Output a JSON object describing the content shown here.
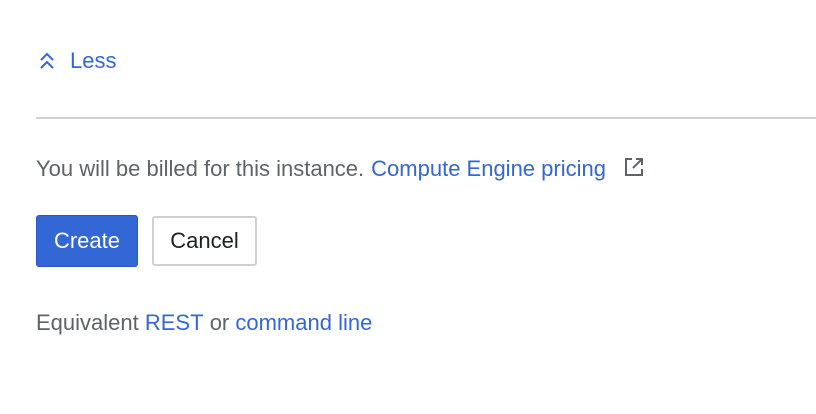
{
  "toggle": {
    "label": "Less",
    "icon": "chevron-double-up-icon"
  },
  "billing": {
    "text": "You will be billed for this instance.",
    "link_label": "Compute Engine pricing",
    "link_icon": "external-link-icon"
  },
  "actions": {
    "create_label": "Create",
    "cancel_label": "Cancel"
  },
  "equivalent": {
    "prefix": "Equivalent",
    "rest_label": "REST",
    "or_text": "or",
    "command_line_label": "command line"
  },
  "colors": {
    "link": "#3367d6",
    "primary_button": "#3367d6",
    "body_text": "#5f6368",
    "divider": "#d3d3d3"
  }
}
